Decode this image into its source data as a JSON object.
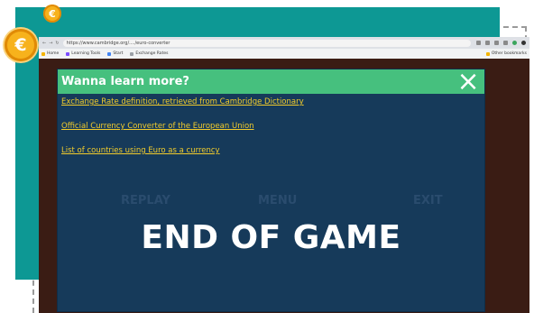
{
  "decor": {
    "coin_symbol": "€",
    "coin_color": "#f7b21c",
    "teal_color": "#0d9894"
  },
  "browser": {
    "url": "https://www.cambridge.org/..../euro-converter",
    "bookmarks": [
      {
        "label": "Home",
        "color": "#f4b400"
      },
      {
        "label": "Learning Tools",
        "color": "#7c4dff"
      },
      {
        "label": "Start",
        "color": "#4285f4"
      },
      {
        "label": "Exchange Rates",
        "color": "#9aa0a6"
      }
    ],
    "bookmarks_right": "Other bookmarks"
  },
  "modal": {
    "title": "Wanna learn more?",
    "close_icon": "×",
    "header_color": "#46c07e",
    "links": [
      "Exchange Rate definition, retrieved from Cambridge Dictionary",
      "Official Currency Converter of the European Union",
      "List of countries using Euro as a currency"
    ],
    "background_buttons": [
      "REPLAY",
      "MENU",
      "EXIT"
    ],
    "end_title": "END OF GAME"
  }
}
